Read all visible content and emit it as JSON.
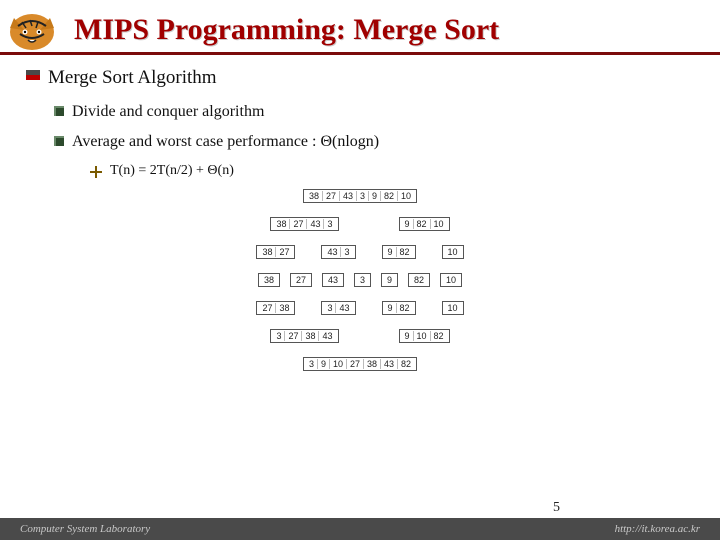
{
  "title": "MIPS Programming: Merge Sort",
  "bullets": {
    "lvl1": "Merge Sort Algorithm",
    "lvl2a": "Divide and conquer algorithm",
    "lvl2b": "Average and worst case performance : Θ(nlogn)",
    "lvl3": "T(n) = 2T(n/2) + Θ(n)"
  },
  "diagram": {
    "r0": [
      [
        "38",
        "27",
        "43",
        "3",
        "9",
        "82",
        "10"
      ]
    ],
    "r1": [
      [
        "38",
        "27",
        "43",
        "3"
      ],
      [
        "9",
        "82",
        "10"
      ]
    ],
    "r2": [
      [
        "38",
        "27"
      ],
      [
        "43",
        "3"
      ],
      [
        "9",
        "82"
      ],
      [
        "10"
      ]
    ],
    "r3": [
      [
        "38"
      ],
      [
        "27"
      ],
      [
        "43"
      ],
      [
        "3"
      ],
      [
        "9"
      ],
      [
        "82"
      ],
      [
        "10"
      ]
    ],
    "r4": [
      [
        "27",
        "38"
      ],
      [
        "3",
        "43"
      ],
      [
        "9",
        "82"
      ],
      [
        "10"
      ]
    ],
    "r5": [
      [
        "3",
        "27",
        "38",
        "43"
      ],
      [
        "9",
        "10",
        "82"
      ]
    ],
    "r6": [
      [
        "3",
        "9",
        "10",
        "27",
        "38",
        "43",
        "82"
      ]
    ]
  },
  "footer": {
    "left": "Computer System Laboratory",
    "right": "http://it.korea.ac.kr"
  },
  "page": "5"
}
